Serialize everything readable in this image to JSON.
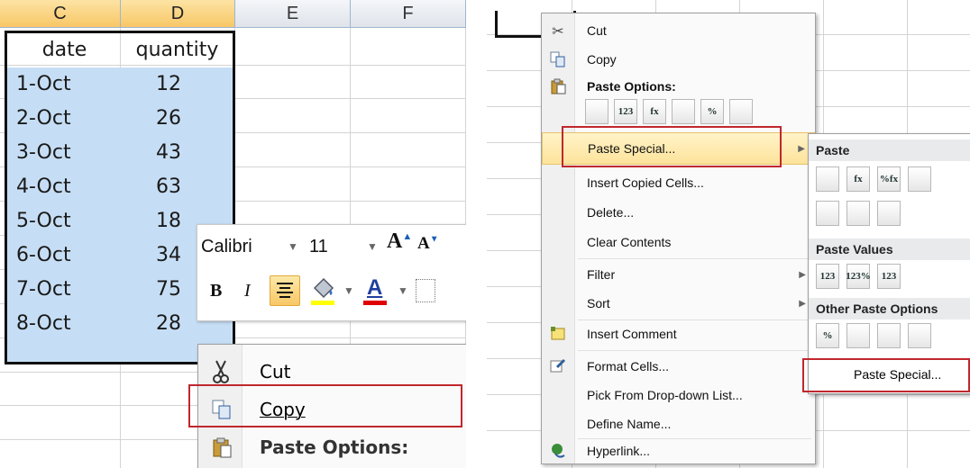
{
  "left": {
    "column_headers": [
      "C",
      "D",
      "E",
      "F"
    ],
    "table": {
      "headers": [
        "date",
        "quantity"
      ],
      "rows": [
        {
          "date": "1-Oct",
          "quantity": "12"
        },
        {
          "date": "2-Oct",
          "quantity": "26"
        },
        {
          "date": "3-Oct",
          "quantity": "43"
        },
        {
          "date": "4-Oct",
          "quantity": "63"
        },
        {
          "date": "5-Oct",
          "quantity": "18"
        },
        {
          "date": "6-Oct",
          "quantity": "34"
        },
        {
          "date": "7-Oct",
          "quantity": "75"
        },
        {
          "date": "8-Oct",
          "quantity": "28"
        }
      ]
    },
    "mini_toolbar": {
      "font_name": "Calibri",
      "font_size": "11",
      "grow_font": "A",
      "shrink_font": "A",
      "bold": "B",
      "italic": "I",
      "font_color_letter": "A",
      "fill_color": "#ffff00",
      "font_color": "#e00000"
    },
    "context_menu": {
      "cut": "Cut",
      "copy": "Copy",
      "paste_options": "Paste Options:"
    }
  },
  "right": {
    "context_menu": {
      "cut": "Cut",
      "copy": "Copy",
      "paste_options": "Paste Options:",
      "paste_buttons": [
        "",
        "123",
        "fx",
        "",
        "%",
        ""
      ],
      "paste_special": "Paste Special...",
      "insert_copied_cells": "Insert Copied Cells...",
      "delete": "Delete...",
      "clear_contents": "Clear Contents",
      "filter": "Filter",
      "sort": "Sort",
      "insert_comment": "Insert Comment",
      "format_cells": "Format Cells...",
      "pick_from_list": "Pick From Drop-down List...",
      "define_name": "Define Name...",
      "hyperlink": "Hyperlink..."
    },
    "submenu": {
      "paste_header": "Paste",
      "paste_buttons": [
        "",
        "fx",
        "%fx",
        "",
        "",
        "",
        ""
      ],
      "paste_values_header": "Paste Values",
      "paste_values_buttons": [
        "123",
        "123%",
        "123"
      ],
      "other_header": "Other Paste Options",
      "other_buttons": [
        "%",
        "",
        "",
        ""
      ],
      "paste_special": "Paste Special..."
    }
  },
  "colors": {
    "selection": "#c6def5",
    "highlight_box": "#c0272d",
    "hover": "#fde9a8"
  }
}
